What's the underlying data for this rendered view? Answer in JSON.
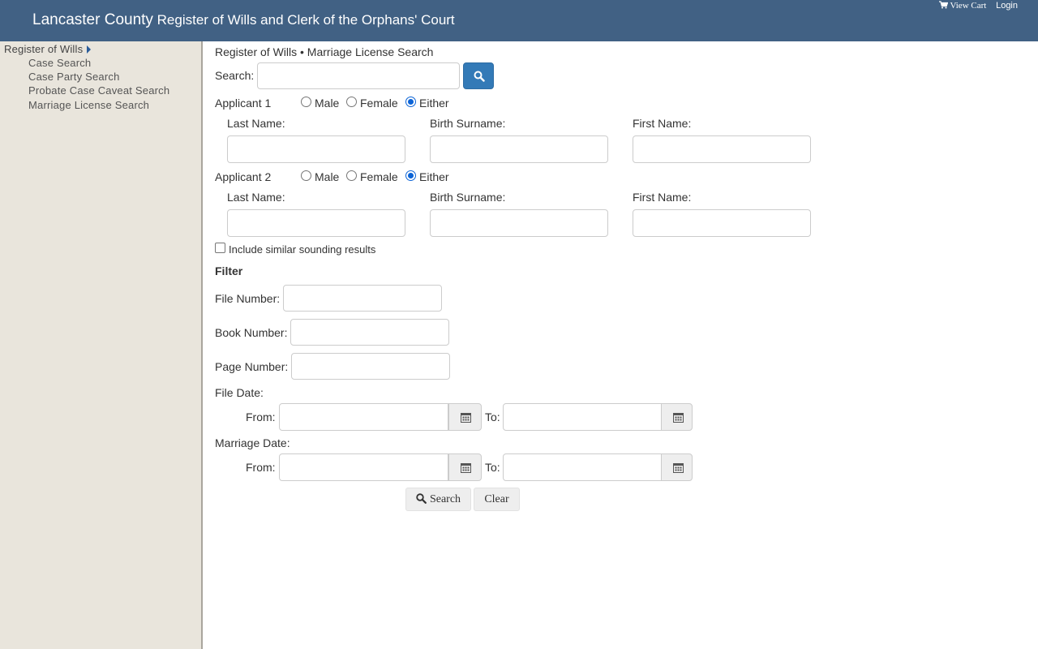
{
  "header": {
    "county": "Lancaster County",
    "office": "Register of Wills and Clerk of the Orphans' Court",
    "view_cart": "View Cart",
    "login": "Login",
    "bg_color": "#416184"
  },
  "sidebar": {
    "root": "Register of Wills",
    "items": [
      {
        "label": "Case Search"
      },
      {
        "label": "Case Party Search"
      },
      {
        "label": "Probate Case Caveat Search"
      },
      {
        "label": "Marriage License Search"
      }
    ]
  },
  "main": {
    "breadcrumb": "Register of Wills • Marriage License Search",
    "search_label": "Search:",
    "search_value": "",
    "applicant1": {
      "label": "Applicant 1",
      "options": [
        "Male",
        "Female",
        "Either"
      ],
      "selected": "Either",
      "last_name_label": "Last Name:",
      "birth_surname_label": "Birth Surname:",
      "first_name_label": "First Name:"
    },
    "applicant2": {
      "label": "Applicant 2",
      "options": [
        "Male",
        "Female",
        "Either"
      ],
      "selected": "Either",
      "last_name_label": "Last Name:",
      "birth_surname_label": "Birth Surname:",
      "first_name_label": "First Name:"
    },
    "similar_label": "Include similar sounding results",
    "filter": {
      "title": "Filter",
      "file_number_label": "File Number:",
      "book_number_label": "Book Number:",
      "page_number_label": "Page Number:",
      "file_date_label": "File Date:",
      "marriage_date_label": "Marriage Date:",
      "from_label": "From:",
      "to_label": "To:"
    },
    "search_button": "Search",
    "clear_button": "Clear",
    "accent_color": "#337ab7"
  }
}
